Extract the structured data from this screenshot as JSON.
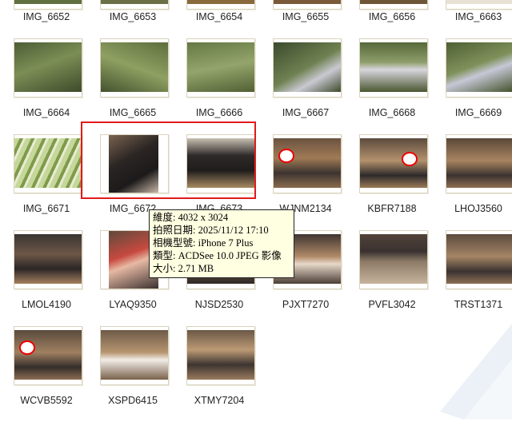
{
  "files": [
    {
      "name": "IMG_6652"
    },
    {
      "name": "IMG_6653"
    },
    {
      "name": "IMG_6654"
    },
    {
      "name": "IMG_6655"
    },
    {
      "name": "IMG_6656"
    },
    {
      "name": "IMG_6663"
    },
    {
      "name": "IMG_6664"
    },
    {
      "name": "IMG_6665"
    },
    {
      "name": "IMG_6666"
    },
    {
      "name": "IMG_6667"
    },
    {
      "name": "IMG_6668"
    },
    {
      "name": "IMG_6669"
    },
    {
      "name": "IMG_6671"
    },
    {
      "name": "IMG_6672"
    },
    {
      "name": "IMG_6673"
    },
    {
      "name": "WJNM2134"
    },
    {
      "name": "KBFR7188"
    },
    {
      "name": "LHOJ3560"
    },
    {
      "name": "LMOL4190"
    },
    {
      "name": "LYAQ9350"
    },
    {
      "name": "NJSD2530"
    },
    {
      "name": "PJXT7270"
    },
    {
      "name": "PVFL3042"
    },
    {
      "name": "TRST1371"
    },
    {
      "name": "WCVB5592"
    },
    {
      "name": "XSPD6415"
    },
    {
      "name": "XTMY7204"
    }
  ],
  "tooltip": {
    "line1": "維度: 4032 x 3024",
    "line2": "拍照日期: 2025/11/12 17:10",
    "line3": "相機型號: iPhone 7 Plus",
    "line4": "類型: ACDSee 10.0 JPEG 影像",
    "line5": "大小: 2.71 MB"
  },
  "colors": {
    "highlight": "#e21a1a",
    "tooltip_bg": "#ffffe1"
  }
}
